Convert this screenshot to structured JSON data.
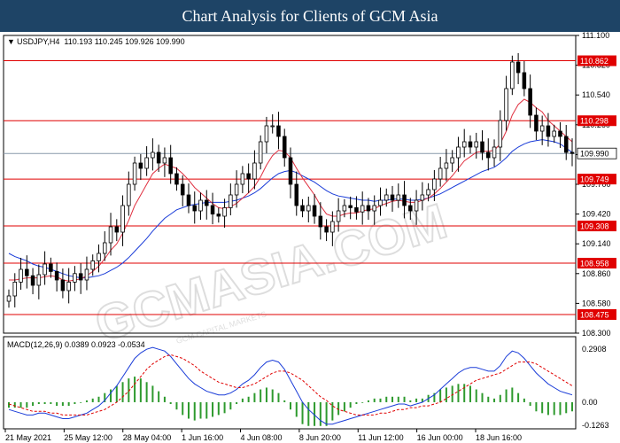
{
  "header": {
    "title": "Chart Analysis for Clients of GCM Asia"
  },
  "watermark": {
    "main": "GCMASIA.COM",
    "sub": "GCM CAPITAL MARKETS"
  },
  "colors": {
    "banner": "#1e4466",
    "level_line": "#e00000",
    "price_line": "#8899aa",
    "ma_fast": "#e03040",
    "ma_slow": "#1a3cd8",
    "macd_hist": "#2e9a2e",
    "macd_line": "#1a3cd8",
    "signal_line": "#e00000",
    "candle": "#000000"
  },
  "chart_data": [
    {
      "type": "candlestick",
      "symbol_info": "USDJPY,H4  110.193 110.245 109.926 109.990",
      "ylim": [
        108.3,
        111.1
      ],
      "y_ticks": [
        "111.100",
        "110.820",
        "110.540",
        "110.260",
        "109.980",
        "109.700",
        "109.420",
        "109.140",
        "108.860",
        "108.580",
        "108.300"
      ],
      "x_ticks": [
        "21 May 2021",
        "25 May 12:00",
        "28 May 04:00",
        "1 Jun 16:00",
        "4 Jun 08:00",
        "8 Jun 20:00",
        "11 Jun 12:00",
        "16 Jun 00:00",
        "18 Jun 16:00"
      ],
      "levels": [
        110.862,
        110.298,
        109.749,
        109.308,
        108.958,
        108.475
      ],
      "current_price": 109.99,
      "close": [
        108.65,
        108.78,
        108.9,
        108.84,
        108.75,
        108.85,
        108.95,
        108.88,
        108.8,
        108.7,
        108.78,
        108.86,
        108.8,
        108.9,
        108.98,
        109.05,
        109.15,
        109.3,
        109.25,
        109.5,
        109.7,
        109.9,
        109.85,
        109.95,
        110.0,
        109.9,
        109.95,
        109.8,
        109.7,
        109.6,
        109.5,
        109.45,
        109.55,
        109.5,
        109.42,
        109.4,
        109.48,
        109.6,
        109.7,
        109.8,
        109.75,
        109.9,
        110.1,
        110.25,
        110.25,
        110.15,
        109.95,
        109.7,
        109.5,
        109.45,
        109.5,
        109.4,
        109.3,
        109.25,
        109.35,
        109.45,
        109.5,
        109.48,
        109.44,
        109.5,
        109.45,
        109.5,
        109.55,
        109.6,
        109.55,
        109.6,
        109.5,
        109.45,
        109.55,
        109.6,
        109.65,
        109.75,
        109.85,
        109.9,
        109.95,
        110.05,
        110.1,
        110.05,
        110.1,
        110.0,
        109.95,
        110.05,
        110.3,
        110.6,
        110.85,
        110.75,
        110.6,
        110.35,
        110.2,
        110.25,
        110.15,
        110.2,
        110.15,
        110.0,
        109.99
      ],
      "ma_fast": [
        108.8,
        108.8,
        108.81,
        108.82,
        108.82,
        108.82,
        108.83,
        108.84,
        108.83,
        108.8,
        108.79,
        108.8,
        108.81,
        108.84,
        108.88,
        108.93,
        109.0,
        109.08,
        109.14,
        109.24,
        109.36,
        109.5,
        109.6,
        109.7,
        109.8,
        109.85,
        109.89,
        109.87,
        109.85,
        109.8,
        109.74,
        109.67,
        109.62,
        109.57,
        109.52,
        109.48,
        109.47,
        109.49,
        109.52,
        109.57,
        109.62,
        109.68,
        109.77,
        109.88,
        109.97,
        110.02,
        110.01,
        109.95,
        109.85,
        109.76,
        109.68,
        109.6,
        109.5,
        109.42,
        109.4,
        109.4,
        109.42,
        109.43,
        109.43,
        109.45,
        109.46,
        109.47,
        109.5,
        109.52,
        109.54,
        109.55,
        109.54,
        109.53,
        109.53,
        109.55,
        109.57,
        109.61,
        109.66,
        109.72,
        109.78,
        109.85,
        109.92,
        109.96,
        110.0,
        110.01,
        110.01,
        110.02,
        110.08,
        110.2,
        110.35,
        110.45,
        110.5,
        110.47,
        110.42,
        110.38,
        110.3,
        110.25,
        110.2,
        110.15,
        110.1
      ],
      "ma_slow": [
        109.05,
        109.02,
        109.0,
        108.98,
        108.95,
        108.93,
        108.92,
        108.9,
        108.88,
        108.86,
        108.84,
        108.83,
        108.82,
        108.82,
        108.83,
        108.84,
        108.86,
        108.89,
        108.92,
        108.96,
        109.01,
        109.07,
        109.13,
        109.19,
        109.26,
        109.32,
        109.38,
        109.42,
        109.46,
        109.48,
        109.5,
        109.51,
        109.52,
        109.53,
        109.53,
        109.53,
        109.53,
        109.54,
        109.55,
        109.57,
        109.59,
        109.62,
        109.66,
        109.71,
        109.76,
        109.8,
        109.82,
        109.83,
        109.81,
        109.78,
        109.75,
        109.72,
        109.68,
        109.64,
        109.61,
        109.59,
        109.58,
        109.57,
        109.56,
        109.55,
        109.55,
        109.54,
        109.55,
        109.55,
        109.56,
        109.56,
        109.56,
        109.55,
        109.55,
        109.56,
        109.57,
        109.59,
        109.61,
        109.64,
        109.67,
        109.7,
        109.73,
        109.76,
        109.79,
        109.82,
        109.84,
        109.86,
        109.9,
        109.95,
        110.01,
        110.05,
        110.08,
        110.1,
        110.11,
        110.12,
        110.11,
        110.1,
        110.08,
        110.04,
        110.0
      ]
    },
    {
      "type": "macd",
      "label": "MACD(12,26,9) 0.0389 0.0923 -0.0534",
      "params": "12,26,9",
      "values_shown": [
        0.0389,
        0.0923,
        -0.0534
      ],
      "ylim": [
        -0.1263,
        0.2908
      ],
      "y_ticks": [
        "0.2908",
        "0.00",
        "-0.1263"
      ],
      "macd": [
        -0.04,
        -0.05,
        -0.06,
        -0.07,
        -0.07,
        -0.06,
        -0.06,
        -0.07,
        -0.08,
        -0.09,
        -0.09,
        -0.08,
        -0.07,
        -0.06,
        -0.04,
        -0.02,
        0.01,
        0.05,
        0.09,
        0.14,
        0.19,
        0.24,
        0.27,
        0.29,
        0.3,
        0.29,
        0.28,
        0.25,
        0.21,
        0.17,
        0.13,
        0.1,
        0.08,
        0.06,
        0.05,
        0.04,
        0.04,
        0.05,
        0.07,
        0.1,
        0.12,
        0.15,
        0.19,
        0.22,
        0.23,
        0.22,
        0.18,
        0.12,
        0.06,
        0.0,
        -0.04,
        -0.07,
        -0.1,
        -0.12,
        -0.12,
        -0.11,
        -0.1,
        -0.09,
        -0.08,
        -0.07,
        -0.06,
        -0.05,
        -0.04,
        -0.03,
        -0.02,
        -0.01,
        -0.01,
        -0.02,
        -0.01,
        0.0,
        0.02,
        0.04,
        0.07,
        0.1,
        0.13,
        0.16,
        0.18,
        0.19,
        0.19,
        0.18,
        0.17,
        0.17,
        0.2,
        0.25,
        0.28,
        0.27,
        0.24,
        0.2,
        0.16,
        0.13,
        0.1,
        0.08,
        0.06,
        0.05,
        0.04
      ],
      "signal": [
        -0.01,
        -0.02,
        -0.03,
        -0.04,
        -0.05,
        -0.05,
        -0.05,
        -0.06,
        -0.06,
        -0.07,
        -0.07,
        -0.07,
        -0.07,
        -0.07,
        -0.06,
        -0.05,
        -0.04,
        -0.02,
        0.0,
        0.03,
        0.06,
        0.1,
        0.14,
        0.18,
        0.21,
        0.23,
        0.25,
        0.26,
        0.25,
        0.24,
        0.22,
        0.2,
        0.17,
        0.15,
        0.13,
        0.11,
        0.1,
        0.09,
        0.08,
        0.08,
        0.09,
        0.1,
        0.12,
        0.14,
        0.16,
        0.17,
        0.17,
        0.16,
        0.14,
        0.12,
        0.09,
        0.06,
        0.03,
        0.01,
        -0.02,
        -0.04,
        -0.05,
        -0.06,
        -0.07,
        -0.07,
        -0.07,
        -0.07,
        -0.06,
        -0.06,
        -0.05,
        -0.04,
        -0.04,
        -0.03,
        -0.03,
        -0.02,
        -0.02,
        -0.01,
        0.0,
        0.02,
        0.04,
        0.06,
        0.08,
        0.1,
        0.12,
        0.13,
        0.14,
        0.15,
        0.16,
        0.18,
        0.2,
        0.22,
        0.22,
        0.22,
        0.21,
        0.19,
        0.17,
        0.15,
        0.13,
        0.11,
        0.09
      ]
    }
  ]
}
